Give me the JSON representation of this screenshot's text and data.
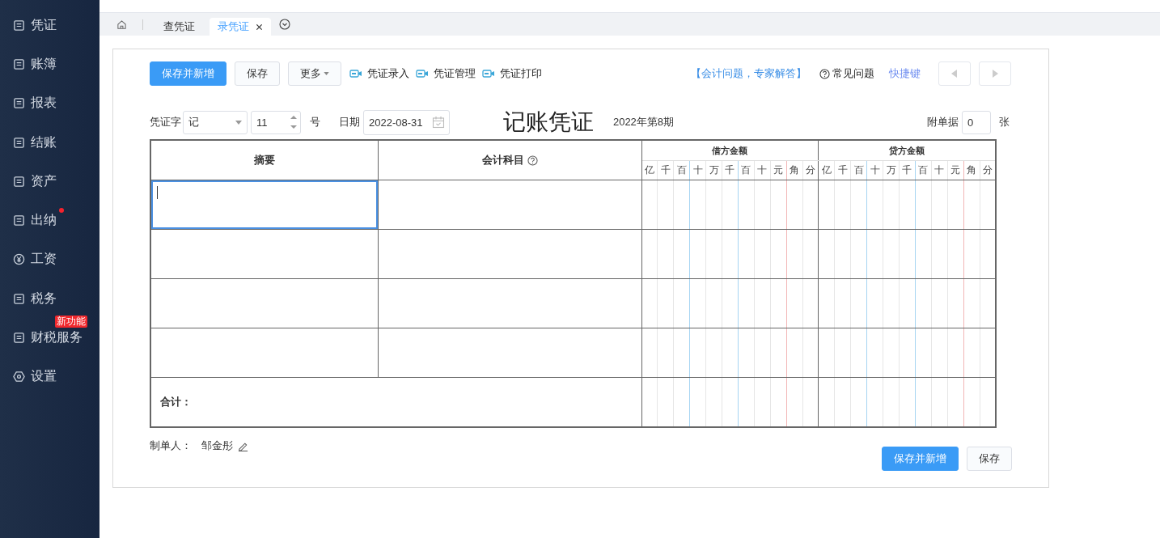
{
  "sidebar": {
    "items": [
      {
        "label": "凭证",
        "dot": false
      },
      {
        "label": "账簿",
        "dot": false
      },
      {
        "label": "报表",
        "dot": false
      },
      {
        "label": "结账",
        "dot": false
      },
      {
        "label": "资产",
        "dot": false
      },
      {
        "label": "出纳",
        "dot": true
      },
      {
        "label": "工资",
        "dot": false
      },
      {
        "label": "税务",
        "dot": false
      },
      {
        "label": "财税服务",
        "dot": false,
        "badge": "新功能"
      },
      {
        "label": "设置",
        "dot": false
      }
    ]
  },
  "tabs": [
    {
      "label": "查凭证",
      "selected": false,
      "closable": false
    },
    {
      "label": "录凭证",
      "selected": true,
      "closable": true
    }
  ],
  "toolbar": {
    "buttons": [
      {
        "label": "保存并新增",
        "kind": "primary"
      },
      {
        "label": "保存",
        "kind": "default"
      },
      {
        "label": "更多",
        "kind": "dropdown"
      }
    ],
    "video_links": [
      "凭证录入",
      "凭证管理",
      "凭证打印"
    ],
    "expert_link": "【会计问题，专家解答】",
    "faq_link": "常见问题",
    "shortcut_link": "快捷键",
    "prev_disabled": true,
    "next_disabled": true
  },
  "voucher": {
    "word_label": "凭证字",
    "word": "记",
    "number": "11",
    "number_suffix": "号",
    "date_label": "日期",
    "date": "2022-08-31",
    "title": "记账凭证",
    "period": "2022年第8期",
    "attachments_label": "附单据",
    "attachments": "0",
    "attachments_unit": "张"
  },
  "table": {
    "columns": [
      "摘要",
      "会计科目"
    ],
    "debit_heading": "借方金额",
    "credit_heading": "贷方金额",
    "debit_digits": [
      "亿",
      "千",
      "百",
      "十",
      "万",
      "千",
      "百",
      "十",
      "元",
      "角",
      "分"
    ],
    "credit_digits": [
      "亿",
      "千",
      "百",
      "十",
      "万",
      "千",
      "百",
      "十",
      "元",
      "角",
      "分"
    ],
    "rows": [
      {
        "active": true
      },
      {
        "active": false
      },
      {
        "active": false
      },
      {
        "active": false
      }
    ],
    "total_label": "合计："
  },
  "footer": {
    "preparer_label": "制单人：",
    "preparer": "邹金彤",
    "buttons": [
      {
        "label": "保存并新增",
        "kind": "primary"
      },
      {
        "label": "保存",
        "kind": "default"
      }
    ]
  }
}
